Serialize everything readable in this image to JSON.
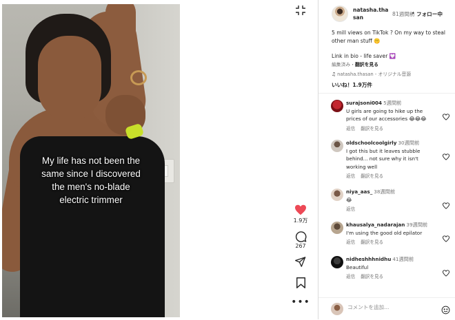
{
  "video": {
    "caption_lines": [
      "My life has not been the",
      "same since I discovered",
      "the men's no-blade",
      "electric trimmer"
    ]
  },
  "actions": {
    "like_count": "1.9万",
    "comment_count": "267",
    "icons": [
      "expand-icon",
      "heart-icon",
      "comment-icon",
      "share-icon",
      "bookmark-icon",
      "more-icon"
    ],
    "like_color": "#ed4956"
  },
  "post": {
    "username": "natasha.thasan",
    "time": "81週間前",
    "dot": "•",
    "follow_label": "フォロー中",
    "text": "5 mill views on TikTok ? On my way to steal other man stuff 🤫",
    "link_text": "Link in bio - life saver 💟",
    "edited_label": "編集済み・",
    "translate_label": "翻訳を見る",
    "audio_user": "natasha.thasan",
    "audio_label": " - オリジナル音源",
    "likes_label": "いいね！1.9万件"
  },
  "comments": [
    {
      "user": "surajsoni004",
      "time": "5週間前",
      "text": "U girls are going to hike up the prices of our accessories 😂😂😂",
      "reply": "返信",
      "translate": "翻訳を見る"
    },
    {
      "user": "oldschoolcoolgirly",
      "time": "30週間前",
      "text": "I got this but it leaves stubble behind... not sure why it isn't working well",
      "reply": "返信",
      "translate": "翻訳を見る"
    },
    {
      "user": "niya_aas_",
      "time": "38週間前",
      "text": "😂",
      "reply": "返信",
      "translate": ""
    },
    {
      "user": "khausalya_nadarajan",
      "time": "39週間前",
      "text": "I'm using the good old epilator",
      "reply": "返信",
      "translate": "翻訳を見る"
    },
    {
      "user": "nidheshhhnidhu",
      "time": "41週間前",
      "text": "Beautiful",
      "reply": "返信",
      "translate": "翻訳を見る"
    }
  ],
  "composer": {
    "placeholder": "コメントを追加..."
  }
}
